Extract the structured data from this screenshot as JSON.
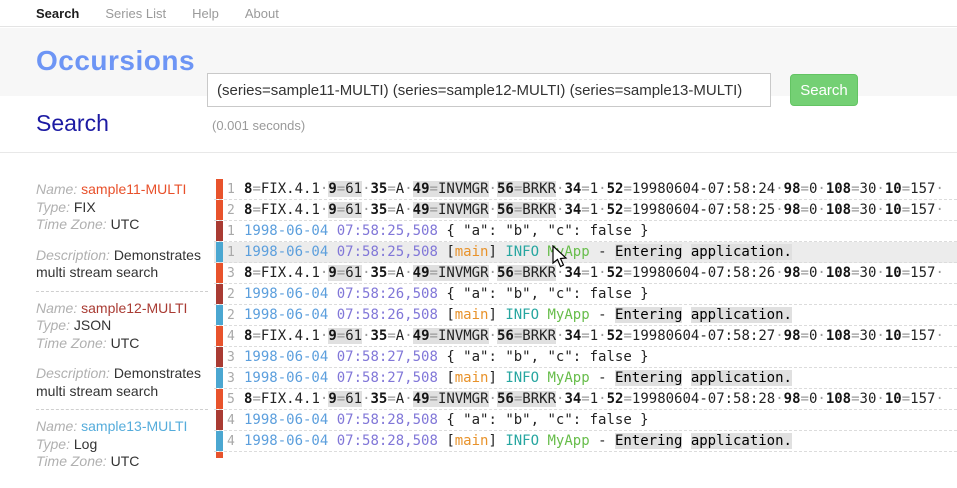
{
  "nav": {
    "items": [
      {
        "label": "Search",
        "active": true
      },
      {
        "label": "Series List",
        "active": false
      },
      {
        "label": "Help",
        "active": false
      },
      {
        "label": "About",
        "active": false
      }
    ]
  },
  "header": {
    "title": "Occursions",
    "query_value": "(series=sample11-MULTI) (series=sample12-MULTI) (series=sample13-MULTI)",
    "search_button": "Search"
  },
  "results": {
    "heading": "Search",
    "timing": "(0.001 seconds)"
  },
  "labels": {
    "name": "Name:",
    "type": "Type:",
    "time_zone": "Time Zone:",
    "description": "Description:"
  },
  "series": [
    {
      "name": "sample11-MULTI",
      "color": "#e8502a",
      "type": "FIX",
      "time_zone": "UTC",
      "description": "Demonstrates multi stream search"
    },
    {
      "name": "sample12-MULTI",
      "color": "#a93b33",
      "type": "JSON",
      "time_zone": "UTC",
      "description": "Demonstrates multi stream search"
    },
    {
      "name": "sample13-MULTI",
      "color": "#55acdb",
      "type": "Log",
      "time_zone": "UTC",
      "description": ""
    }
  ],
  "log": {
    "stream_colors": [
      "#e8532c",
      "#a93b33",
      "#4ba7d1"
    ],
    "rows": [
      {
        "stream": 0,
        "line": "1",
        "hovered": false,
        "segments": [
          [
            "t",
            "8"
          ],
          [
            "e",
            "="
          ],
          [
            "v",
            "FIX.4.1"
          ],
          [
            "s",
            "·"
          ],
          [
            "t hl",
            "9"
          ],
          [
            "e hl",
            "="
          ],
          [
            "v hl",
            "61"
          ],
          [
            "s",
            "·"
          ],
          [
            "t",
            "35"
          ],
          [
            "e",
            "="
          ],
          [
            "v",
            "A"
          ],
          [
            "s",
            "·"
          ],
          [
            "t hl",
            "49"
          ],
          [
            "e hl",
            "="
          ],
          [
            "v hl",
            "INVMGR"
          ],
          [
            "s",
            "·"
          ],
          [
            "t hl",
            "56"
          ],
          [
            "e hl",
            "="
          ],
          [
            "v hl",
            "BRKR"
          ],
          [
            "s",
            "·"
          ],
          [
            "t",
            "34"
          ],
          [
            "e",
            "="
          ],
          [
            "v",
            "1"
          ],
          [
            "s",
            "·"
          ],
          [
            "t",
            "52"
          ],
          [
            "e",
            "="
          ],
          [
            "v",
            "19980604-07:58:24"
          ],
          [
            "s",
            "·"
          ],
          [
            "t",
            "98"
          ],
          [
            "e",
            "="
          ],
          [
            "v",
            "0"
          ],
          [
            "s",
            "·"
          ],
          [
            "t",
            "108"
          ],
          [
            "e",
            "="
          ],
          [
            "v",
            "30"
          ],
          [
            "s",
            "·"
          ],
          [
            "t",
            "10"
          ],
          [
            "e",
            "="
          ],
          [
            "v",
            "157"
          ],
          [
            "s",
            "·"
          ]
        ]
      },
      {
        "stream": 0,
        "line": "2",
        "hovered": false,
        "segments": [
          [
            "t",
            "8"
          ],
          [
            "e",
            "="
          ],
          [
            "v",
            "FIX.4.1"
          ],
          [
            "s",
            "·"
          ],
          [
            "t hl",
            "9"
          ],
          [
            "e hl",
            "="
          ],
          [
            "v hl",
            "61"
          ],
          [
            "s",
            "·"
          ],
          [
            "t",
            "35"
          ],
          [
            "e",
            "="
          ],
          [
            "v",
            "A"
          ],
          [
            "s",
            "·"
          ],
          [
            "t hl",
            "49"
          ],
          [
            "e hl",
            "="
          ],
          [
            "v hl",
            "INVMGR"
          ],
          [
            "s",
            "·"
          ],
          [
            "t hl",
            "56"
          ],
          [
            "e hl",
            "="
          ],
          [
            "v hl",
            "BRKR"
          ],
          [
            "s",
            "·"
          ],
          [
            "t",
            "34"
          ],
          [
            "e",
            "="
          ],
          [
            "v",
            "1"
          ],
          [
            "s",
            "·"
          ],
          [
            "t",
            "52"
          ],
          [
            "e",
            "="
          ],
          [
            "v",
            "19980604-07:58:25"
          ],
          [
            "s",
            "·"
          ],
          [
            "t",
            "98"
          ],
          [
            "e",
            "="
          ],
          [
            "v",
            "0"
          ],
          [
            "s",
            "·"
          ],
          [
            "t",
            "108"
          ],
          [
            "e",
            "="
          ],
          [
            "v",
            "30"
          ],
          [
            "s",
            "·"
          ],
          [
            "t",
            "10"
          ],
          [
            "e",
            "="
          ],
          [
            "v",
            "157"
          ],
          [
            "s",
            "·"
          ]
        ]
      },
      {
        "stream": 1,
        "line": "1",
        "hovered": false,
        "segments": [
          [
            "d",
            "1998-06-04"
          ],
          [
            "p",
            " "
          ],
          [
            "tm",
            "07:58:25,508"
          ],
          [
            "p",
            " { \"a\": \"b\", \"c\": false }"
          ]
        ]
      },
      {
        "stream": 2,
        "line": "1",
        "hovered": true,
        "segments": [
          [
            "d",
            "1998-06-04"
          ],
          [
            "p",
            " "
          ],
          [
            "tm",
            "07:58:25,508"
          ],
          [
            "p",
            " ["
          ],
          [
            "mn",
            "main"
          ],
          [
            "p",
            "] "
          ],
          [
            "in",
            "INFO"
          ],
          [
            "p",
            " "
          ],
          [
            "ap",
            "MyApp"
          ],
          [
            "p",
            " - "
          ],
          [
            "hl",
            "Entering"
          ],
          [
            "p",
            " "
          ],
          [
            "hl",
            "application."
          ]
        ]
      },
      {
        "stream": 0,
        "line": "3",
        "hovered": false,
        "segments": [
          [
            "t",
            "8"
          ],
          [
            "e",
            "="
          ],
          [
            "v",
            "FIX.4.1"
          ],
          [
            "s",
            "·"
          ],
          [
            "t hl",
            "9"
          ],
          [
            "e hl",
            "="
          ],
          [
            "v hl",
            "61"
          ],
          [
            "s",
            "·"
          ],
          [
            "t",
            "35"
          ],
          [
            "e",
            "="
          ],
          [
            "v",
            "A"
          ],
          [
            "s",
            "·"
          ],
          [
            "t hl",
            "49"
          ],
          [
            "e hl",
            "="
          ],
          [
            "v hl",
            "INVMGR"
          ],
          [
            "s",
            "·"
          ],
          [
            "t hl",
            "56"
          ],
          [
            "e hl",
            "="
          ],
          [
            "v hl",
            "BRKR"
          ],
          [
            "s",
            "·"
          ],
          [
            "t",
            "34"
          ],
          [
            "e",
            "="
          ],
          [
            "v",
            "1"
          ],
          [
            "s",
            "·"
          ],
          [
            "t",
            "52"
          ],
          [
            "e",
            "="
          ],
          [
            "v",
            "19980604-07:58:26"
          ],
          [
            "s",
            "·"
          ],
          [
            "t",
            "98"
          ],
          [
            "e",
            "="
          ],
          [
            "v",
            "0"
          ],
          [
            "s",
            "·"
          ],
          [
            "t",
            "108"
          ],
          [
            "e",
            "="
          ],
          [
            "v",
            "30"
          ],
          [
            "s",
            "·"
          ],
          [
            "t",
            "10"
          ],
          [
            "e",
            "="
          ],
          [
            "v",
            "157"
          ],
          [
            "s",
            "·"
          ]
        ]
      },
      {
        "stream": 1,
        "line": "2",
        "hovered": false,
        "segments": [
          [
            "d",
            "1998-06-04"
          ],
          [
            "p",
            " "
          ],
          [
            "tm",
            "07:58:26,508"
          ],
          [
            "p",
            " { \"a\": \"b\", \"c\": false }"
          ]
        ]
      },
      {
        "stream": 2,
        "line": "2",
        "hovered": false,
        "segments": [
          [
            "d",
            "1998-06-04"
          ],
          [
            "p",
            " "
          ],
          [
            "tm",
            "07:58:26,508"
          ],
          [
            "p",
            " ["
          ],
          [
            "mn",
            "main"
          ],
          [
            "p",
            "] "
          ],
          [
            "in",
            "INFO"
          ],
          [
            "p",
            " "
          ],
          [
            "ap",
            "MyApp"
          ],
          [
            "p",
            " - "
          ],
          [
            "hl",
            "Entering"
          ],
          [
            "p",
            " "
          ],
          [
            "hl",
            "application."
          ]
        ]
      },
      {
        "stream": 0,
        "line": "4",
        "hovered": false,
        "segments": [
          [
            "t",
            "8"
          ],
          [
            "e",
            "="
          ],
          [
            "v",
            "FIX.4.1"
          ],
          [
            "s",
            "·"
          ],
          [
            "t hl",
            "9"
          ],
          [
            "e hl",
            "="
          ],
          [
            "v hl",
            "61"
          ],
          [
            "s",
            "·"
          ],
          [
            "t",
            "35"
          ],
          [
            "e",
            "="
          ],
          [
            "v",
            "A"
          ],
          [
            "s",
            "·"
          ],
          [
            "t hl",
            "49"
          ],
          [
            "e hl",
            "="
          ],
          [
            "v hl",
            "INVMGR"
          ],
          [
            "s",
            "·"
          ],
          [
            "t hl",
            "56"
          ],
          [
            "e hl",
            "="
          ],
          [
            "v hl",
            "BRKR"
          ],
          [
            "s",
            "·"
          ],
          [
            "t",
            "34"
          ],
          [
            "e",
            "="
          ],
          [
            "v",
            "1"
          ],
          [
            "s",
            "·"
          ],
          [
            "t",
            "52"
          ],
          [
            "e",
            "="
          ],
          [
            "v",
            "19980604-07:58:27"
          ],
          [
            "s",
            "·"
          ],
          [
            "t",
            "98"
          ],
          [
            "e",
            "="
          ],
          [
            "v",
            "0"
          ],
          [
            "s",
            "·"
          ],
          [
            "t",
            "108"
          ],
          [
            "e",
            "="
          ],
          [
            "v",
            "30"
          ],
          [
            "s",
            "·"
          ],
          [
            "t",
            "10"
          ],
          [
            "e",
            "="
          ],
          [
            "v",
            "157"
          ],
          [
            "s",
            "·"
          ]
        ]
      },
      {
        "stream": 1,
        "line": "3",
        "hovered": false,
        "segments": [
          [
            "d",
            "1998-06-04"
          ],
          [
            "p",
            " "
          ],
          [
            "tm",
            "07:58:27,508"
          ],
          [
            "p",
            " { \"a\": \"b\", \"c\": false }"
          ]
        ]
      },
      {
        "stream": 2,
        "line": "3",
        "hovered": false,
        "segments": [
          [
            "d",
            "1998-06-04"
          ],
          [
            "p",
            " "
          ],
          [
            "tm",
            "07:58:27,508"
          ],
          [
            "p",
            " ["
          ],
          [
            "mn",
            "main"
          ],
          [
            "p",
            "] "
          ],
          [
            "in",
            "INFO"
          ],
          [
            "p",
            " "
          ],
          [
            "ap",
            "MyApp"
          ],
          [
            "p",
            " - "
          ],
          [
            "hl",
            "Entering"
          ],
          [
            "p",
            " "
          ],
          [
            "hl",
            "application."
          ]
        ]
      },
      {
        "stream": 0,
        "line": "5",
        "hovered": false,
        "segments": [
          [
            "t",
            "8"
          ],
          [
            "e",
            "="
          ],
          [
            "v",
            "FIX.4.1"
          ],
          [
            "s",
            "·"
          ],
          [
            "t hl",
            "9"
          ],
          [
            "e hl",
            "="
          ],
          [
            "v hl",
            "61"
          ],
          [
            "s",
            "·"
          ],
          [
            "t",
            "35"
          ],
          [
            "e",
            "="
          ],
          [
            "v",
            "A"
          ],
          [
            "s",
            "·"
          ],
          [
            "t hl",
            "49"
          ],
          [
            "e hl",
            "="
          ],
          [
            "v hl",
            "INVMGR"
          ],
          [
            "s",
            "·"
          ],
          [
            "t hl",
            "56"
          ],
          [
            "e hl",
            "="
          ],
          [
            "v hl",
            "BRKR"
          ],
          [
            "s",
            "·"
          ],
          [
            "t",
            "34"
          ],
          [
            "e",
            "="
          ],
          [
            "v",
            "1"
          ],
          [
            "s",
            "·"
          ],
          [
            "t",
            "52"
          ],
          [
            "e",
            "="
          ],
          [
            "v",
            "19980604-07:58:28"
          ],
          [
            "s",
            "·"
          ],
          [
            "t",
            "98"
          ],
          [
            "e",
            "="
          ],
          [
            "v",
            "0"
          ],
          [
            "s",
            "·"
          ],
          [
            "t",
            "108"
          ],
          [
            "e",
            "="
          ],
          [
            "v",
            "30"
          ],
          [
            "s",
            "·"
          ],
          [
            "t",
            "10"
          ],
          [
            "e",
            "="
          ],
          [
            "v",
            "157"
          ],
          [
            "s",
            "·"
          ]
        ]
      },
      {
        "stream": 1,
        "line": "4",
        "hovered": false,
        "segments": [
          [
            "d",
            "1998-06-04"
          ],
          [
            "p",
            " "
          ],
          [
            "tm",
            "07:58:28,508"
          ],
          [
            "p",
            " { \"a\": \"b\", \"c\": false }"
          ]
        ]
      },
      {
        "stream": 2,
        "line": "4",
        "hovered": false,
        "segments": [
          [
            "d",
            "1998-06-04"
          ],
          [
            "p",
            " "
          ],
          [
            "tm",
            "07:58:28,508"
          ],
          [
            "p",
            " ["
          ],
          [
            "mn",
            "main"
          ],
          [
            "p",
            "] "
          ],
          [
            "in",
            "INFO"
          ],
          [
            "p",
            " "
          ],
          [
            "ap",
            "MyApp"
          ],
          [
            "p",
            " - "
          ],
          [
            "hl",
            "Entering"
          ],
          [
            "p",
            " "
          ],
          [
            "hl",
            "application."
          ]
        ]
      },
      {
        "stream": 0,
        "line": "",
        "hovered": false,
        "partial": true,
        "segments": []
      }
    ]
  }
}
